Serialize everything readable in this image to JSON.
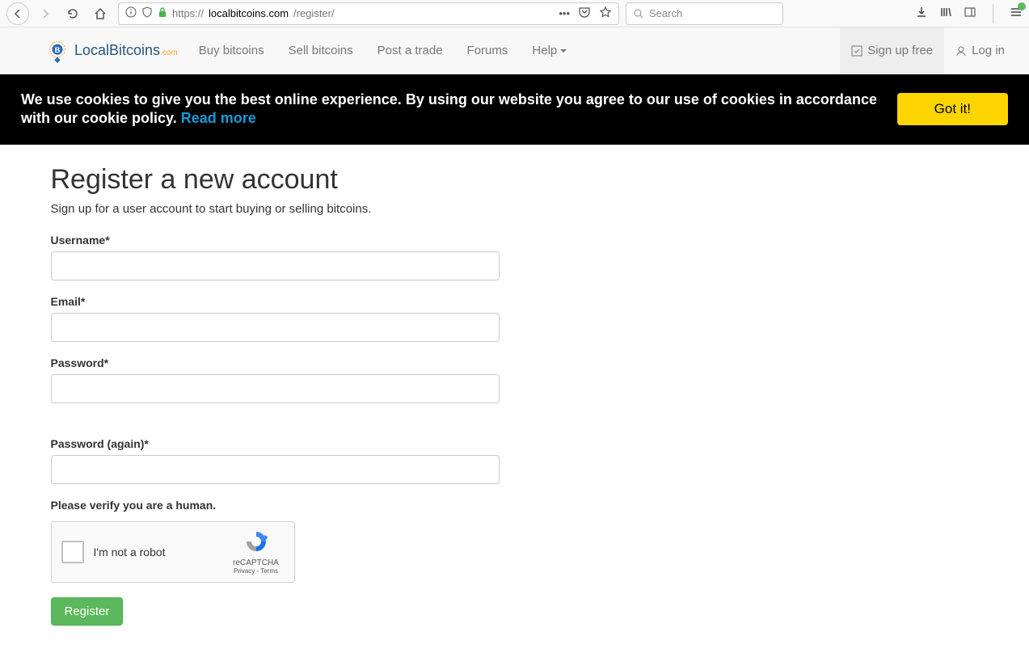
{
  "browser": {
    "url_protocol": "https://",
    "url_domain": "localbitcoins.com",
    "url_path": "/register/",
    "search_placeholder": "Search"
  },
  "nav": {
    "brand_main": "LocalBitcoins",
    "brand_suffix": ".com",
    "links": {
      "buy": "Buy bitcoins",
      "sell": "Sell bitcoins",
      "post": "Post a trade",
      "forums": "Forums",
      "help": "Help"
    },
    "signup": "Sign up free",
    "login": "Log in"
  },
  "cookie": {
    "text_part1": "We use cookies to give you the best online experience. By using our website you agree to our use of cookies in accordance with our cookie policy. ",
    "read_more": "Read more",
    "button": "Got it!"
  },
  "page": {
    "title": "Register a new account",
    "subtitle": "Sign up for a user account to start buying or selling bitcoins."
  },
  "form": {
    "username_label": "Username*",
    "email_label": "Email*",
    "password_label": "Password*",
    "password2_label": "Password (again)*",
    "verify_label": "Please verify you are a human.",
    "recaptcha_text": "I'm not a robot",
    "recaptcha_brand": "reCAPTCHA",
    "recaptcha_links": "Privacy - Terms",
    "register_button": "Register"
  }
}
